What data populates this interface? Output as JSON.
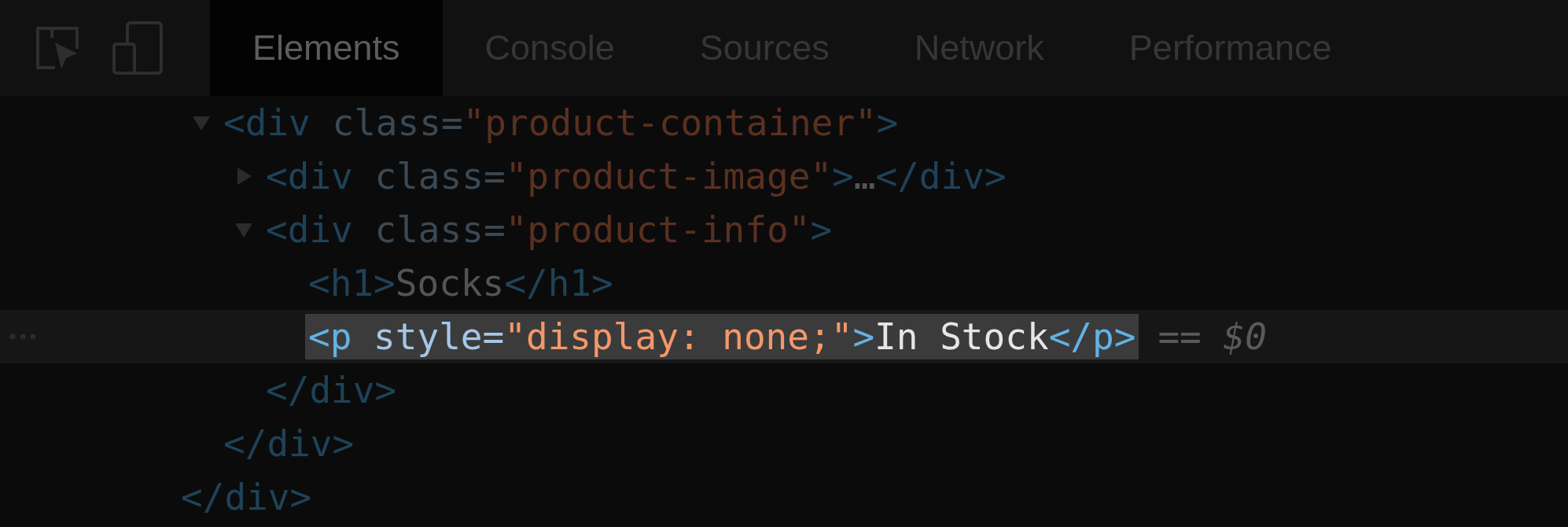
{
  "toolbar": {
    "tools": [
      {
        "kind": "inspect"
      },
      {
        "kind": "device"
      }
    ],
    "tabs": [
      {
        "label": "Elements",
        "selected": true
      },
      {
        "label": "Console",
        "selected": false
      },
      {
        "label": "Sources",
        "selected": false
      },
      {
        "label": "Network",
        "selected": false
      },
      {
        "label": "Performance",
        "selected": false
      }
    ]
  },
  "dom_tree": {
    "close": [
      {
        "kind": "tag",
        "text": "</div>"
      }
    ],
    "children": [
      {
        "expanded": true,
        "open": [
          {
            "kind": "tag",
            "text": "<div"
          },
          {
            "kind": "attr",
            "text": " class="
          },
          {
            "kind": "value",
            "text": "\"product-container\""
          },
          {
            "kind": "tag",
            "text": ">"
          }
        ],
        "close": [
          {
            "kind": "tag",
            "text": "</div>"
          }
        ],
        "children": [
          {
            "expanded": false,
            "open": [
              {
                "kind": "tag",
                "text": "<div"
              },
              {
                "kind": "attr",
                "text": " class="
              },
              {
                "kind": "value",
                "text": "\"product-image\""
              },
              {
                "kind": "tag",
                "text": ">"
              },
              {
                "kind": "text",
                "text": "…"
              },
              {
                "kind": "tag",
                "text": "</div>"
              }
            ]
          },
          {
            "expanded": true,
            "open": [
              {
                "kind": "tag",
                "text": "<div"
              },
              {
                "kind": "attr",
                "text": " class="
              },
              {
                "kind": "value",
                "text": "\"product-info\""
              },
              {
                "kind": "tag",
                "text": ">"
              }
            ],
            "close": [
              {
                "kind": "tag",
                "text": "</div>"
              }
            ],
            "children": [
              {
                "open": [
                  {
                    "kind": "tag",
                    "text": "<h1>"
                  },
                  {
                    "kind": "text",
                    "text": "Socks"
                  },
                  {
                    "kind": "tag",
                    "text": "</h1>"
                  }
                ]
              },
              {
                "selected": true,
                "suffix": "== $0",
                "open": [
                  {
                    "kind": "tag",
                    "text": "<p"
                  },
                  {
                    "kind": "attr",
                    "text": " style="
                  },
                  {
                    "kind": "value",
                    "text": "\"display: none;\""
                  },
                  {
                    "kind": "tag",
                    "text": ">"
                  },
                  {
                    "kind": "text",
                    "text": "In Stock"
                  },
                  {
                    "kind": "tag",
                    "text": "</p>"
                  }
                ]
              }
            ]
          }
        ]
      }
    ]
  }
}
